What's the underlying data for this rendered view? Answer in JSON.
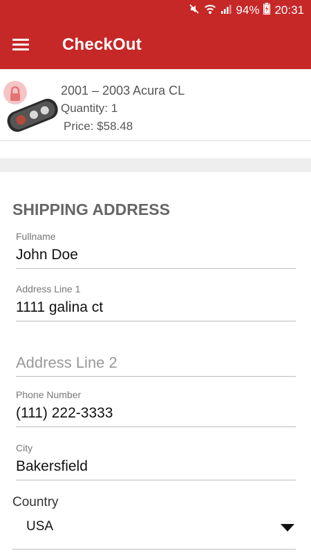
{
  "status_bar": {
    "battery": "94%",
    "time": "20:31",
    "icons": [
      "mute-icon",
      "wifi-icon",
      "signal-icon",
      "battery-icon"
    ]
  },
  "app_bar": {
    "title": "CheckOut",
    "menu_icon": "hamburger-menu-icon"
  },
  "product": {
    "name": "2001 – 2003 Acura CL",
    "quantity": "Quantity: 1",
    "price": "Price: $58.48"
  },
  "shipping": {
    "title": "SHIPPING ADDRESS",
    "fullname": {
      "label": "Fullname",
      "value": "John Doe"
    },
    "address1": {
      "label": "Address Line 1",
      "value": "1111 galina ct"
    },
    "address2": {
      "placeholder": "Address Line 2"
    },
    "phone": {
      "label": "Phone Number",
      "value": "(111) 222-3333"
    },
    "city": {
      "label": "City",
      "value": "Bakersfield"
    },
    "country": {
      "label": "Country",
      "value": "USA"
    }
  },
  "colors": {
    "primary": "#c62828",
    "divider": "#eeeeee"
  }
}
